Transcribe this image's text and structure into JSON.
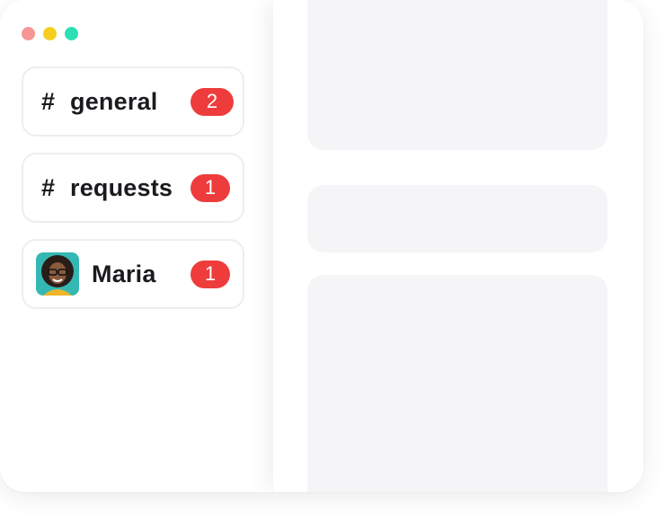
{
  "window": {
    "traffic_lights": [
      "#f79595",
      "#f5cf1e",
      "#2ddfb3"
    ]
  },
  "sidebar": {
    "channels": [
      {
        "prefix": "#",
        "label": "general",
        "badge": "2"
      },
      {
        "prefix": "#",
        "label": "requests",
        "badge": "1"
      }
    ],
    "dm": {
      "label": "Maria",
      "badge": "1"
    }
  },
  "colors": {
    "badge": "#ee3c3c",
    "placeholder": "#f5f5f7"
  }
}
